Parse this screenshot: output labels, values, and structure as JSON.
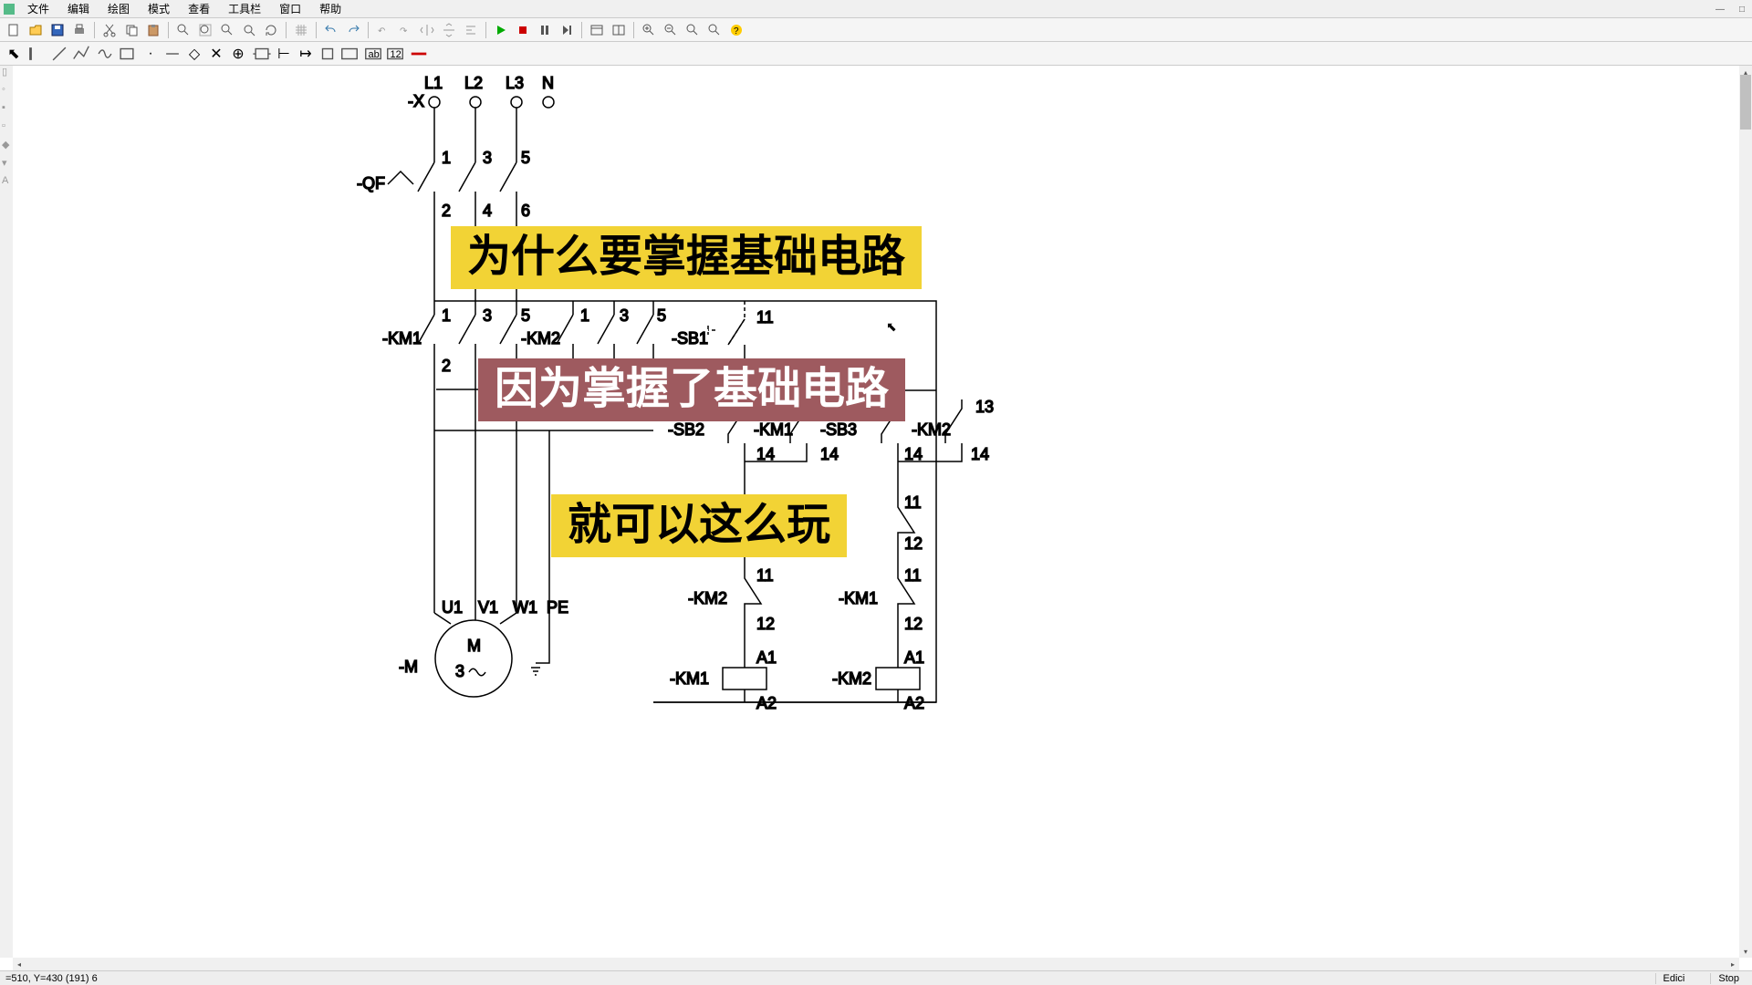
{
  "menu": {
    "items": [
      "文件",
      "编辑",
      "绘图",
      "模式",
      "查看",
      "工具栏",
      "窗口",
      "帮助"
    ]
  },
  "window": {
    "min": "—",
    "max": "□",
    "close": "×"
  },
  "toolbar_icons": [
    "new",
    "open",
    "save",
    "print",
    "cut",
    "copy",
    "paste",
    "find",
    "zoom-fit",
    "zoom-win",
    "zoom-all",
    "refresh",
    "grid",
    "undo",
    "redo",
    "rot-l",
    "rot-r",
    "flip-h",
    "flip-v",
    "align",
    "play",
    "stop",
    "pause",
    "step",
    "win1",
    "win2",
    "zoom-in",
    "zoom-out",
    "zoom-sel",
    "zoom-pg",
    "help"
  ],
  "toolbar2_icons": [
    "ptr",
    "hand",
    "line",
    "mline",
    "coil",
    "rect",
    "dot",
    "seg",
    "node",
    "crs",
    "pin",
    "blk",
    "io",
    "arr",
    "box",
    "frm",
    "a",
    "b",
    "red"
  ],
  "overlays": {
    "t1": "为什么要掌握基础电路",
    "t2": "因为掌握了基础电路",
    "t3": "就可以这么玩"
  },
  "labels": {
    "X": "-X",
    "L1": "L1",
    "L2": "L2",
    "L3": "L3",
    "N": "N",
    "QF": "-QF",
    "KM1": "-KM1",
    "KM2": "-KM2",
    "SB1": "-SB1",
    "SB2": "-SB2",
    "SB3": "-SB3",
    "M": "-M",
    "Msym": "M",
    "M3": "3",
    "U1": "U1",
    "V1": "V1",
    "W1": "W1",
    "PE": "PE",
    "n1": "1",
    "n2": "2",
    "n3": "3",
    "n4": "4",
    "n5": "5",
    "n6": "6",
    "n11": "11",
    "n12": "12",
    "n13": "13",
    "n14": "14",
    "A1": "A1",
    "A2": "A2"
  },
  "status": {
    "coords": "=510, Y=430 (191) 6",
    "mode": "Edici",
    "stop": "Stop"
  },
  "palette": [
    "#000",
    "#888",
    "#f00",
    "#ff8000",
    "#8f8f00",
    "#0a0",
    "#0ff",
    "#00f",
    "#80f",
    "#f0f"
  ]
}
